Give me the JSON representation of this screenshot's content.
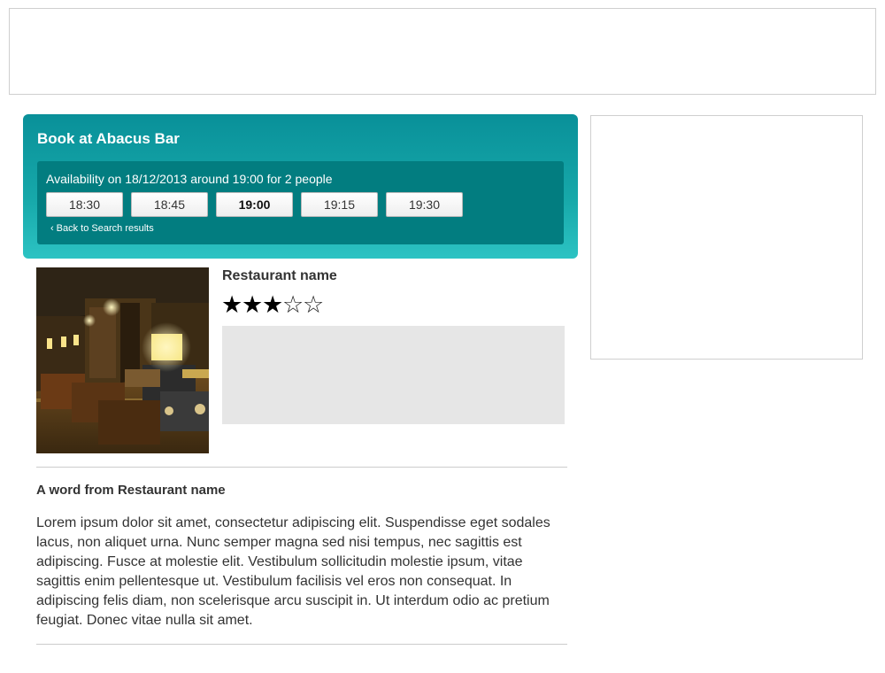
{
  "booking": {
    "title": "Book at Abacus Bar",
    "availability_text": "Availability on 18/12/2013 around 19:00 for 2 people",
    "time_slots": [
      {
        "label": "18:30",
        "selected": false
      },
      {
        "label": "18:45",
        "selected": false
      },
      {
        "label": "19:00",
        "selected": true
      },
      {
        "label": "19:15",
        "selected": false
      },
      {
        "label": "19:30",
        "selected": false
      }
    ],
    "back_chevron": "‹",
    "back_label": "Back to Search results"
  },
  "restaurant": {
    "name": "Restaurant name",
    "rating": {
      "value": 3,
      "max": 5,
      "filled_glyph": "★",
      "empty_glyph": "☆"
    }
  },
  "word": {
    "heading": "A word from Restaurant name",
    "body": "Lorem ipsum dolor sit amet, consectetur adipiscing elit. Suspendisse eget sodales lacus, non aliquet urna. Nunc semper magna sed nisi tempus, nec sagittis est adipiscing. Fusce at molestie elit. Vestibulum sollicitudin molestie ipsum, vitae sagittis enim pellentesque ut. Vestibulum facilisis vel eros non consequat. In adipiscing felis diam, non scelerisque arcu suscipit in. Ut interdum odio ac pretium feugiat. Donec vitae nulla sit amet."
  },
  "colors": {
    "panel_top": "#099099",
    "panel_bottom": "#2cc3c3",
    "availability_bg": "#027d80",
    "placeholder_gray": "#e6e6e6"
  }
}
